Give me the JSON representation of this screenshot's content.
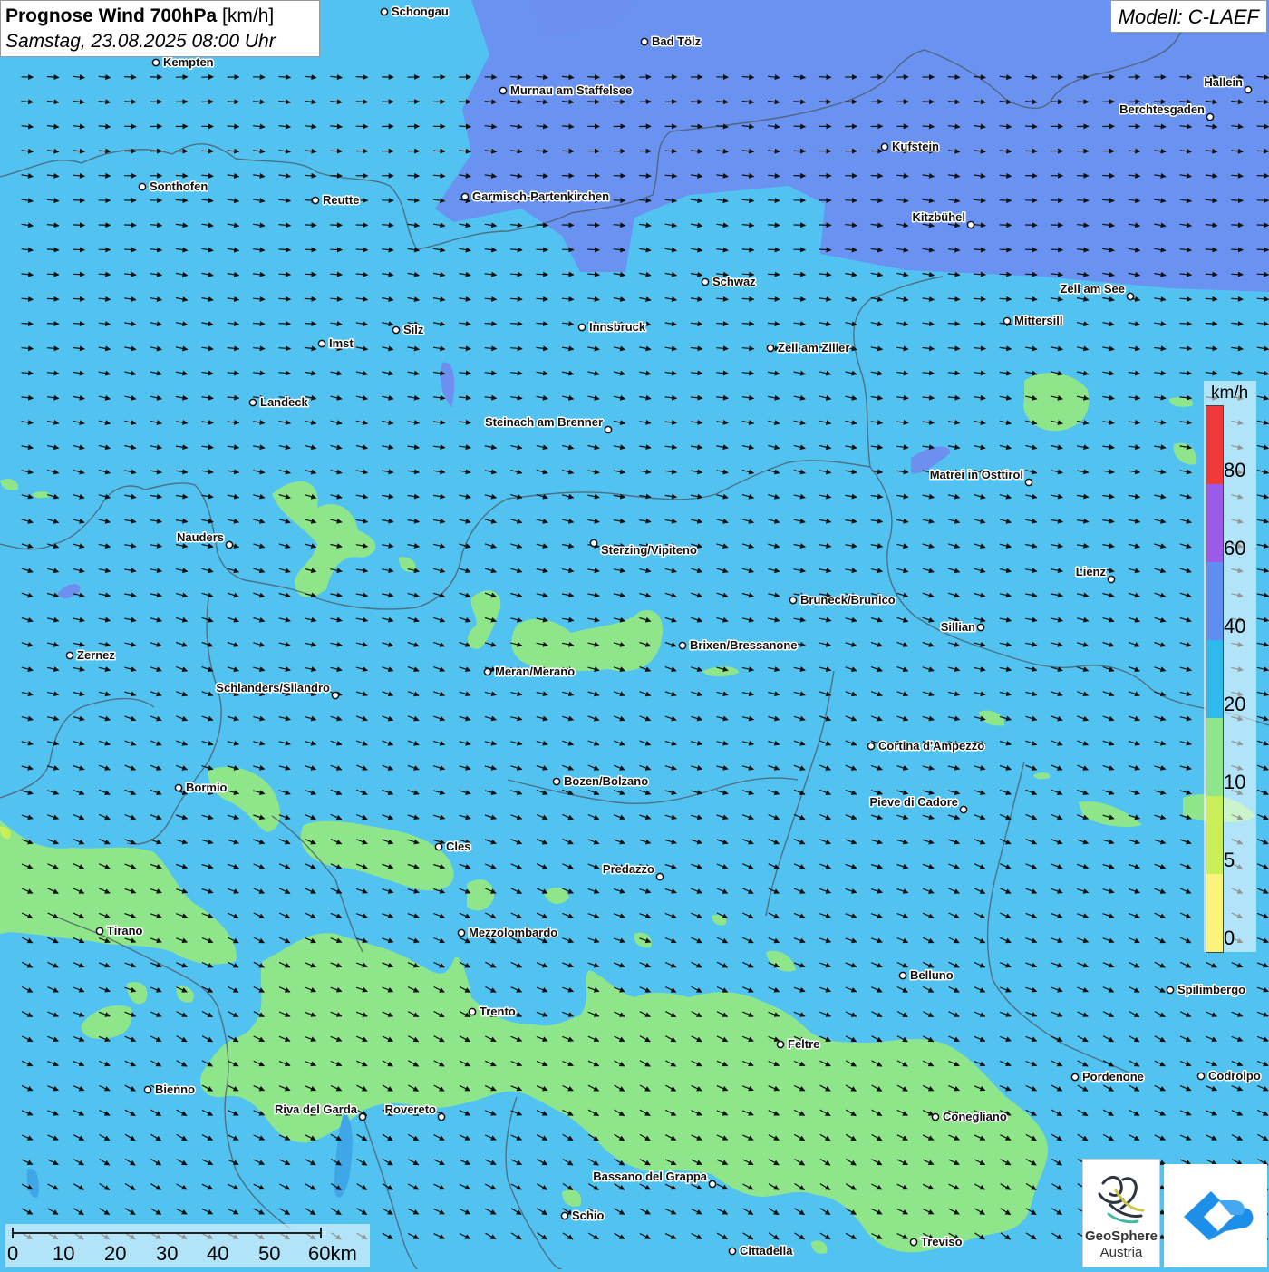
{
  "title": {
    "bold": "Prognose Wind 700hPa",
    "unit": "[km/h]",
    "date": "Samstag, 23.08.2025 08:00 Uhr"
  },
  "model": "Modell: C-LAEF",
  "legend": {
    "unit": "km/h",
    "labels": [
      "80",
      "60",
      "40",
      "20",
      "10",
      "5",
      "0"
    ],
    "colors": [
      "#f03a3a",
      "#9b5be8",
      "#5f8ef0",
      "#2fb9ec",
      "#8fe68a",
      "#c9ef58",
      "#fbf47a"
    ]
  },
  "scale": {
    "labels": [
      "0",
      "10",
      "20",
      "30",
      "40",
      "50",
      "60km"
    ]
  },
  "logo": {
    "name": "GeoSphere",
    "sub": "Austria"
  },
  "cities": [
    {
      "name": "Schongau"
    },
    {
      "name": "Bad Tölz"
    },
    {
      "name": "Kempten"
    },
    {
      "name": "Murnau am Staffelsee"
    },
    {
      "name": "Hallein"
    },
    {
      "name": "Berchtesgaden"
    },
    {
      "name": "Kufstein"
    },
    {
      "name": "Sonthofen"
    },
    {
      "name": "Reutte"
    },
    {
      "name": "Garmisch-Partenkirchen"
    },
    {
      "name": "Kitzbühel"
    },
    {
      "name": "Schwaz"
    },
    {
      "name": "Zell am See"
    },
    {
      "name": "Mittersill"
    },
    {
      "name": "Silz"
    },
    {
      "name": "Innsbruck"
    },
    {
      "name": "Imst"
    },
    {
      "name": "Zell am Ziller"
    },
    {
      "name": "Landeck"
    },
    {
      "name": "Steinach am Brenner"
    },
    {
      "name": "Matrei in Osttirol"
    },
    {
      "name": "Nauders"
    },
    {
      "name": "Sterzing/Vipiteno"
    },
    {
      "name": "Lienz"
    },
    {
      "name": "Bruneck/Brunico"
    },
    {
      "name": "Sillian"
    },
    {
      "name": "Brixen/Bressanone"
    },
    {
      "name": "Zernez"
    },
    {
      "name": "Meran/Merano"
    },
    {
      "name": "Schlanders/Silandro"
    },
    {
      "name": "Cortina d'Ampezzo"
    },
    {
      "name": "Bozen/Bolzano"
    },
    {
      "name": "Pieve di Cadore"
    },
    {
      "name": "Bormio"
    },
    {
      "name": "Cles"
    },
    {
      "name": "Predazzo"
    },
    {
      "name": "Tirano"
    },
    {
      "name": "Mezzolombardo"
    },
    {
      "name": "Belluno"
    },
    {
      "name": "Spilimbergo"
    },
    {
      "name": "Trento"
    },
    {
      "name": "Feltre"
    },
    {
      "name": "Pordenone"
    },
    {
      "name": "Codroipo"
    },
    {
      "name": "Bienno"
    },
    {
      "name": "Riva del Garda"
    },
    {
      "name": "Rovereto"
    },
    {
      "name": "Conegliano"
    },
    {
      "name": "Bassano del Grappa"
    },
    {
      "name": "Schio"
    },
    {
      "name": "Treviso"
    },
    {
      "name": "Cittadella"
    }
  ]
}
